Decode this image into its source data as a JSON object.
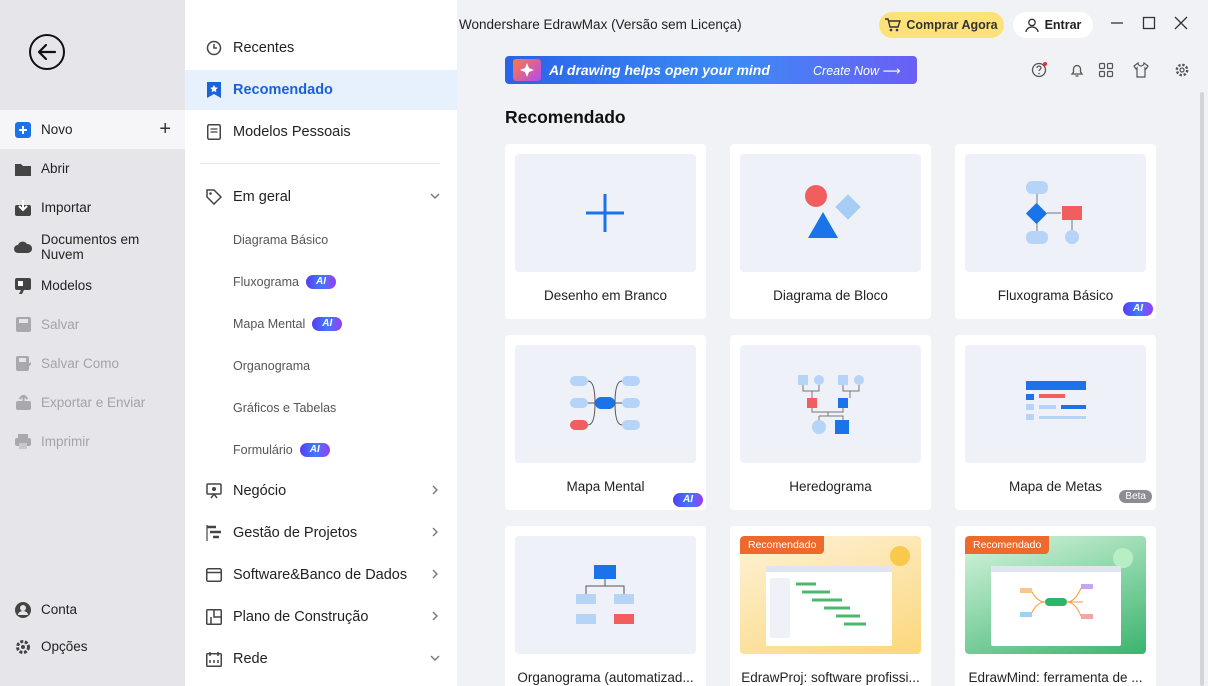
{
  "window": {
    "title": "Wondershare EdrawMax (Versão sem Licença)",
    "buy_label": "Comprar Agora",
    "login_label": "Entrar"
  },
  "rail": {
    "items": [
      {
        "label": "Novo",
        "icon": "plus-square-icon"
      },
      {
        "label": "Abrir",
        "icon": "folder-icon"
      },
      {
        "label": "Importar",
        "icon": "import-icon"
      },
      {
        "label": "Documentos em Nuvem",
        "icon": "cloud-icon"
      },
      {
        "label": "Modelos",
        "icon": "templates-icon"
      },
      {
        "label": "Salvar",
        "icon": "save-icon"
      },
      {
        "label": "Salvar Como",
        "icon": "save-as-icon"
      },
      {
        "label": "Exportar e Enviar",
        "icon": "export-icon"
      },
      {
        "label": "Imprimir",
        "icon": "print-icon"
      },
      {
        "label": "Conta",
        "icon": "account-icon"
      },
      {
        "label": "Opções",
        "icon": "gear-icon"
      }
    ]
  },
  "categories": {
    "top": [
      {
        "label": "Recentes",
        "icon": "clock-icon"
      },
      {
        "label": "Recomendado",
        "icon": "star-bookmark-icon"
      },
      {
        "label": "Modelos Pessoais",
        "icon": "document-icon"
      }
    ],
    "general": {
      "label": "Em geral",
      "icon": "tag-icon"
    },
    "sub": [
      {
        "label": "Diagrama Básico",
        "ai": false
      },
      {
        "label": "Fluxograma",
        "ai": true
      },
      {
        "label": "Mapa Mental",
        "ai": true
      },
      {
        "label": "Organograma",
        "ai": false
      },
      {
        "label": "Gráficos e Tabelas",
        "ai": false
      },
      {
        "label": "Formulário",
        "ai": true
      }
    ],
    "more": [
      {
        "label": "Negócio",
        "icon": "presentation-icon"
      },
      {
        "label": "Gestão de Projetos",
        "icon": "gantt-icon"
      },
      {
        "label": "Software&Banco de Dados",
        "icon": "window-icon"
      },
      {
        "label": "Plano de Construção",
        "icon": "floorplan-icon"
      },
      {
        "label": "Rede",
        "icon": "network-icon"
      }
    ],
    "ai_badge": "AI"
  },
  "banner": {
    "text": "AI drawing helps open your mind",
    "cta": "Create Now"
  },
  "main": {
    "section_title": "Recomendado",
    "cards": [
      {
        "label": "Desenho em Branco"
      },
      {
        "label": "Diagrama de Bloco"
      },
      {
        "label": "Fluxograma Básico",
        "badge": "AI"
      },
      {
        "label": "Mapa Mental",
        "badge": "AI"
      },
      {
        "label": "Heredograma"
      },
      {
        "label": "Mapa de Metas",
        "badge": "Beta"
      },
      {
        "label": "Organograma (automatizad..."
      },
      {
        "label": "EdrawProj: software profissi...",
        "tag": "Recomendado"
      },
      {
        "label": "EdrawMind: ferramenta de ...",
        "tag": "Recomendado"
      }
    ]
  },
  "colors": {
    "accent": "#1a62d6",
    "buy_bg": "#fde27a",
    "reco_tag": "#ee6a2c"
  }
}
